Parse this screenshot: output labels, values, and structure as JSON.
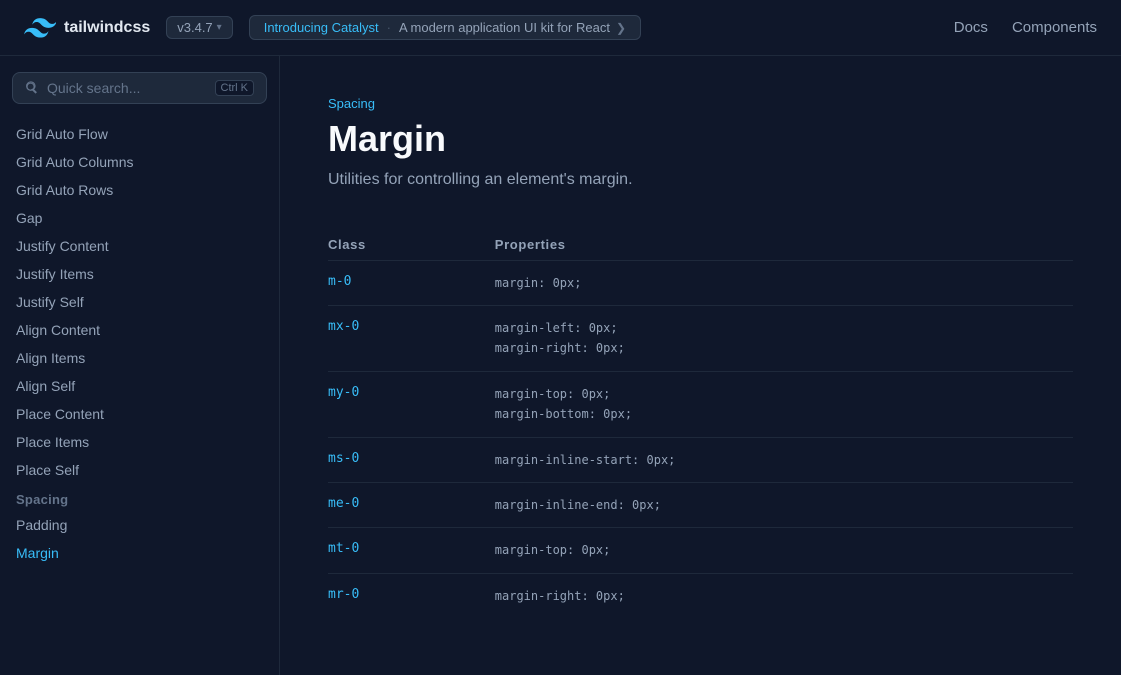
{
  "header": {
    "logo_text": "tailwindcss",
    "version": "v3.4.7",
    "announcement_label": "Introducing Catalyst",
    "announcement_separator": "·",
    "announcement_link": "A modern application UI kit for React",
    "announcement_arrow": "❯",
    "nav": [
      {
        "label": "Docs",
        "id": "docs"
      },
      {
        "label": "Components",
        "id": "components"
      }
    ]
  },
  "search": {
    "placeholder": "Quick search...",
    "shortcut": "Ctrl K"
  },
  "sidebar": {
    "items_above": [
      {
        "label": "Grid Auto Flow",
        "id": "grid-auto-flow",
        "active": false
      },
      {
        "label": "Grid Auto Columns",
        "id": "grid-auto-columns",
        "active": false
      },
      {
        "label": "Grid Auto Rows",
        "id": "grid-auto-rows",
        "active": false
      },
      {
        "label": "Gap",
        "id": "gap",
        "active": false
      },
      {
        "label": "Justify Content",
        "id": "justify-content",
        "active": false
      },
      {
        "label": "Justify Items",
        "id": "justify-items",
        "active": false
      },
      {
        "label": "Justify Self",
        "id": "justify-self",
        "active": false
      },
      {
        "label": "Align Content",
        "id": "align-content",
        "active": false
      },
      {
        "label": "Align Items",
        "id": "align-items",
        "active": false
      },
      {
        "label": "Align Self",
        "id": "align-self",
        "active": false
      },
      {
        "label": "Place Content",
        "id": "place-content",
        "active": false
      },
      {
        "label": "Place Items",
        "id": "place-items",
        "active": false
      },
      {
        "label": "Place Self",
        "id": "place-self",
        "active": false
      }
    ],
    "section_label": "Spacing",
    "spacing_items": [
      {
        "label": "Padding",
        "id": "padding",
        "active": false
      },
      {
        "label": "Margin",
        "id": "margin",
        "active": true
      }
    ]
  },
  "content": {
    "breadcrumb": "Spacing",
    "title": "Margin",
    "subtitle": "Utilities for controlling an element's margin.",
    "table": {
      "columns": [
        "Class",
        "Properties"
      ],
      "rows": [
        {
          "class": "m-0",
          "properties": [
            "margin: 0px;"
          ]
        },
        {
          "class": "mx-0",
          "properties": [
            "margin-left: 0px;",
            "margin-right: 0px;"
          ]
        },
        {
          "class": "my-0",
          "properties": [
            "margin-top: 0px;",
            "margin-bottom: 0px;"
          ]
        },
        {
          "class": "ms-0",
          "properties": [
            "margin-inline-start: 0px;"
          ]
        },
        {
          "class": "me-0",
          "properties": [
            "margin-inline-end: 0px;"
          ]
        },
        {
          "class": "mt-0",
          "properties": [
            "margin-top: 0px;"
          ]
        },
        {
          "class": "mr-0",
          "properties": [
            "margin-right: 0px;"
          ]
        }
      ]
    }
  },
  "colors": {
    "accent": "#38bdf8",
    "bg_primary": "#0f172a",
    "bg_secondary": "#1e293b",
    "border": "#1e293b",
    "text_muted": "#64748b",
    "text_secondary": "#94a3b8",
    "text_primary": "#f8fafc"
  }
}
